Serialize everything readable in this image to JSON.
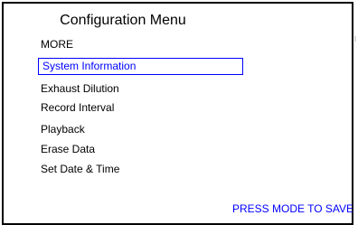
{
  "title": "Configuration Menu",
  "menu": {
    "items": [
      {
        "label": "MORE",
        "selected": false
      },
      {
        "label": "System Information",
        "selected": true
      },
      {
        "label": "Exhaust Dilution",
        "selected": false
      },
      {
        "label": "Record Interval",
        "selected": false
      },
      {
        "label": "Playback",
        "selected": false
      },
      {
        "label": "Erase Data",
        "selected": false
      },
      {
        "label": "Set Date & Time",
        "selected": false
      }
    ]
  },
  "footer": "PRESS MODE TO SAVE",
  "colors": {
    "text": "#000000",
    "highlight": "#0000ff",
    "background": "#ffffff"
  }
}
